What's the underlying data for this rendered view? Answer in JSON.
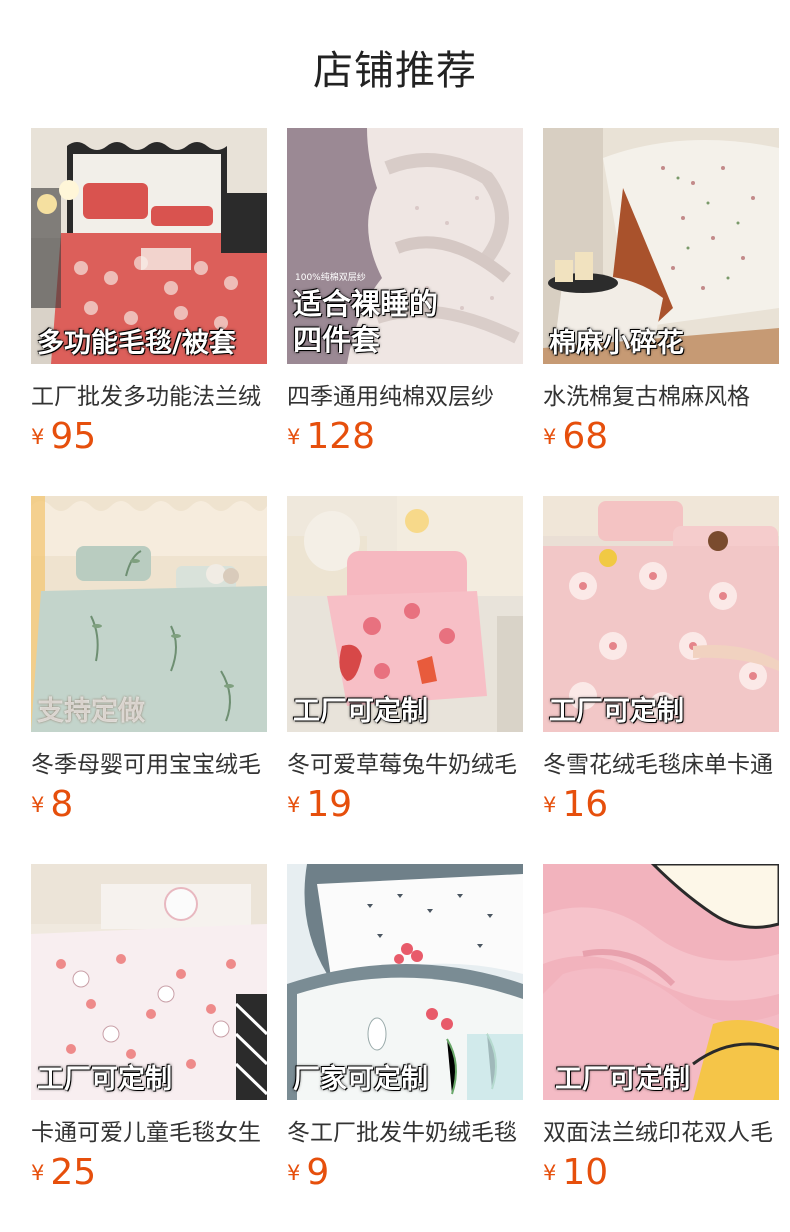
{
  "section_title": "店铺推荐",
  "currency": "¥",
  "accent_color": "#e64f0c",
  "products": [
    {
      "name": "工厂批发多功能法兰绒",
      "price": "95",
      "overlay": "多功能毛毯/被套",
      "badge": ""
    },
    {
      "name": "四季通用纯棉双层纱",
      "price": "128",
      "overlay": "适合裸睡的\n四件套",
      "badge": "100%纯棉双层纱"
    },
    {
      "name": "水洗棉复古棉麻风格",
      "price": "68",
      "overlay": "棉麻小碎花",
      "badge": ""
    },
    {
      "name": "冬季母婴可用宝宝绒毛",
      "price": "8",
      "overlay": "支持定做",
      "badge": ""
    },
    {
      "name": "冬可爱草莓兔牛奶绒毛",
      "price": "19",
      "overlay": "工厂可定制",
      "badge": ""
    },
    {
      "name": "冬雪花绒毛毯床单卡通",
      "price": "16",
      "overlay": "工厂可定制",
      "badge": ""
    },
    {
      "name": "卡通可爱儿童毛毯女生",
      "price": "25",
      "overlay": "工厂可定制",
      "badge": ""
    },
    {
      "name": "冬工厂批发牛奶绒毛毯",
      "price": "9",
      "overlay": "厂家可定制",
      "badge": ""
    },
    {
      "name": "双面法兰绒印花双人毛",
      "price": "10",
      "overlay": "工厂可定制",
      "badge": ""
    }
  ]
}
